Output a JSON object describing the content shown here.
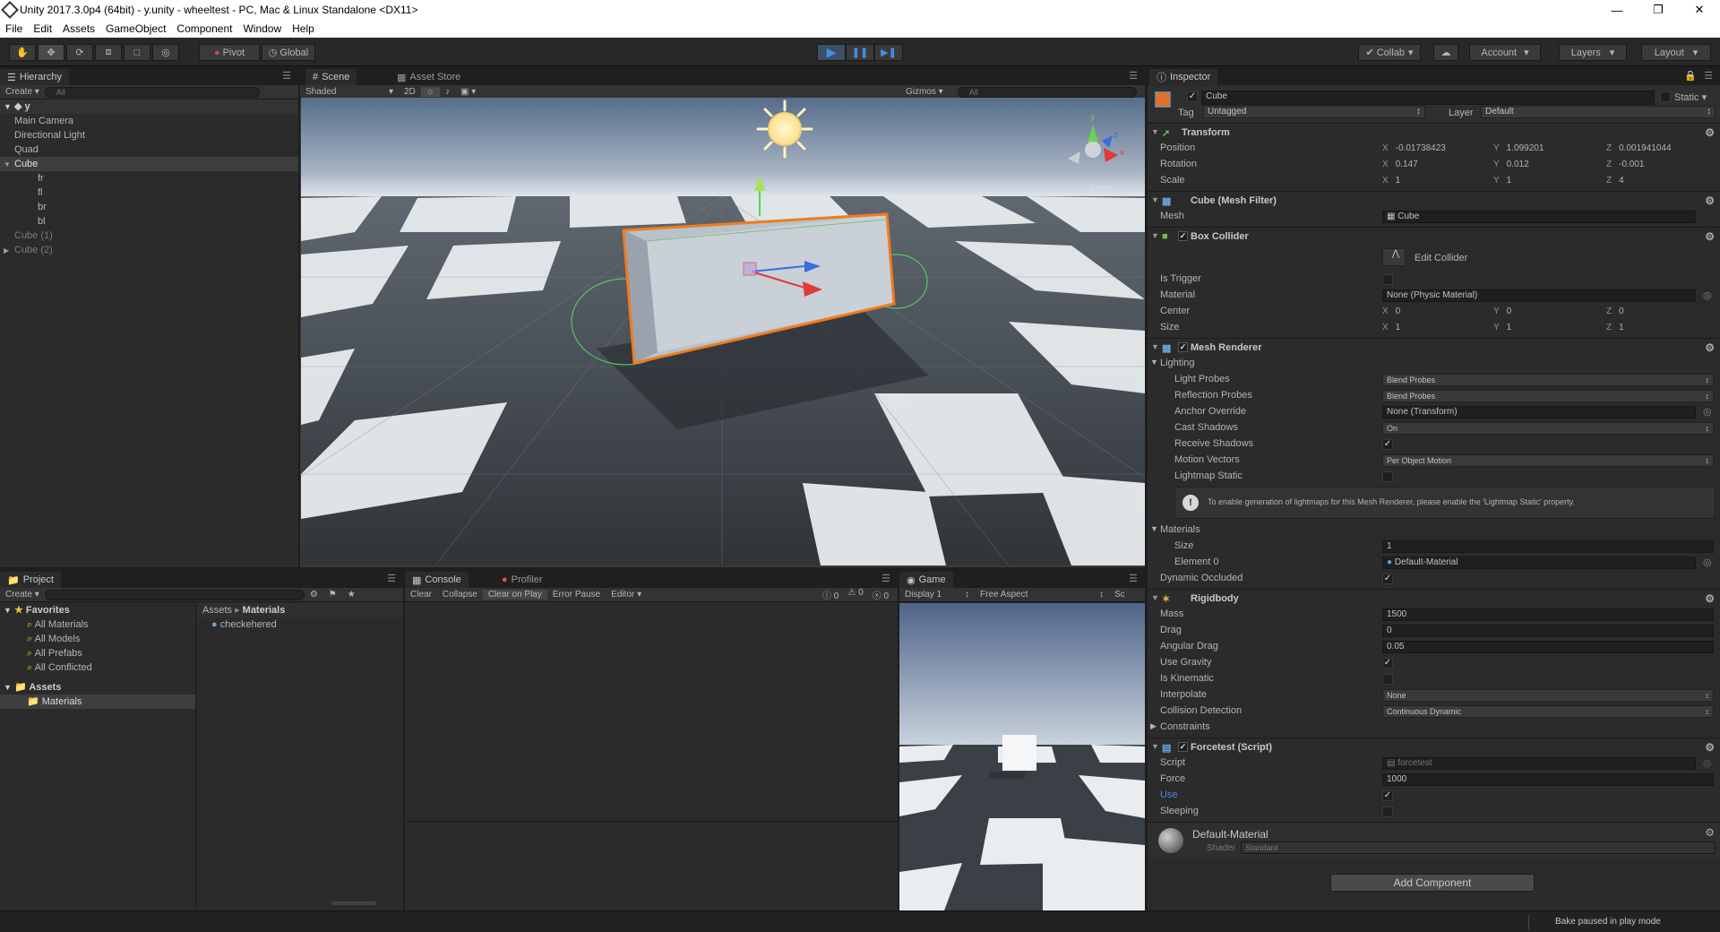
{
  "window": {
    "title": "Unity 2017.3.0p4 (64bit) - y.unity - wheeltest - PC, Mac & Linux Standalone <DX11>"
  },
  "menu": [
    "File",
    "Edit",
    "Assets",
    "GameObject",
    "Component",
    "Window",
    "Help"
  ],
  "toolbar": {
    "pivot": "Pivot",
    "global": "Global",
    "collab": "Collab",
    "account": "Account",
    "layers": "Layers",
    "layout": "Layout"
  },
  "hierarchy": {
    "tab": "Hierarchy",
    "create": "Create",
    "search_placeholder": "All",
    "scene_name": "y",
    "items": [
      {
        "label": "Main Camera",
        "depth": 1
      },
      {
        "label": "Directional Light",
        "depth": 1
      },
      {
        "label": "Quad",
        "depth": 1
      },
      {
        "label": "Cube",
        "depth": 1,
        "selected": true,
        "expanded": true
      },
      {
        "label": "fr",
        "depth": 2
      },
      {
        "label": "fl",
        "depth": 2
      },
      {
        "label": "br",
        "depth": 2
      },
      {
        "label": "bl",
        "depth": 2
      },
      {
        "label": "Cube (1)",
        "depth": 1,
        "muted": true
      },
      {
        "label": "Cube (2)",
        "depth": 1,
        "muted": true,
        "collapsed": true
      }
    ]
  },
  "scene": {
    "tabs": [
      "Scene",
      "Asset Store"
    ],
    "shading": "Shaded",
    "mode2d": "2D",
    "gizmos": "Gizmos",
    "search_placeholder": "All",
    "persp": "Persp"
  },
  "project": {
    "tab": "Project",
    "create": "Create",
    "favorites": {
      "label": "Favorites",
      "items": [
        "All Materials",
        "All Models",
        "All Prefabs",
        "All Conflicted"
      ]
    },
    "assets": {
      "label": "Assets",
      "items": [
        "Materials"
      ]
    },
    "breadcrumb": [
      "Assets",
      "Materials"
    ],
    "files": [
      "checkehered"
    ]
  },
  "console": {
    "tabs": [
      "Console",
      "Profiler"
    ],
    "buttons": [
      "Clear",
      "Collapse",
      "Clear on Play",
      "Error Pause",
      "Editor"
    ],
    "counts": [
      "0",
      "0",
      "0"
    ]
  },
  "game": {
    "tab": "Game",
    "display": "Display 1",
    "aspect": "Free Aspect",
    "scale": "Sc"
  },
  "inspector": {
    "tab": "Inspector",
    "object_name": "Cube",
    "static": "Static",
    "tag_label": "Tag",
    "tag": "Untagged",
    "layer_label": "Layer",
    "layer": "Default",
    "transform": {
      "title": "Transform",
      "rows": [
        {
          "label": "Position",
          "x": "-0.01738423",
          "y": "1.099201",
          "z": "0.001941044"
        },
        {
          "label": "Rotation",
          "x": "0.147",
          "y": "0.012",
          "z": "-0.001"
        },
        {
          "label": "Scale",
          "x": "1",
          "y": "1",
          "z": "4"
        }
      ]
    },
    "mesh_filter": {
      "title": "Cube (Mesh Filter)",
      "mesh_label": "Mesh",
      "mesh": "Cube"
    },
    "box_collider": {
      "title": "Box Collider",
      "edit": "Edit Collider",
      "is_trigger": "Is Trigger",
      "material_label": "Material",
      "material": "None (Physic Material)",
      "center": {
        "label": "Center",
        "x": "0",
        "y": "0",
        "z": "0"
      },
      "size": {
        "label": "Size",
        "x": "1",
        "y": "1",
        "z": "1"
      }
    },
    "mesh_renderer": {
      "title": "Mesh Renderer",
      "lighting": "Lighting",
      "light_probes": {
        "label": "Light Probes",
        "value": "Blend Probes"
      },
      "reflection_probes": {
        "label": "Reflection Probes",
        "value": "Blend Probes"
      },
      "anchor_override": {
        "label": "Anchor Override",
        "value": "None (Transform)"
      },
      "cast_shadows": {
        "label": "Cast Shadows",
        "value": "On"
      },
      "receive_shadows": "Receive Shadows",
      "motion_vectors": {
        "label": "Motion Vectors",
        "value": "Per Object Motion"
      },
      "lightmap_static": "Lightmap Static",
      "info": "To enable generation of lightmaps for this Mesh Renderer, please enable the 'Lightmap Static' property.",
      "materials": "Materials",
      "size_label": "Size",
      "size": "1",
      "element_label": "Element 0",
      "element": "Default-Material",
      "dynamic_occluded": "Dynamic Occluded"
    },
    "rigidbody": {
      "title": "Rigidbody",
      "mass_label": "Mass",
      "mass": "1500",
      "drag_label": "Drag",
      "drag": "0",
      "angular_drag_label": "Angular Drag",
      "angular_drag": "0.05",
      "use_gravity": "Use Gravity",
      "is_kinematic": "Is Kinematic",
      "interpolate_label": "Interpolate",
      "interpolate": "None",
      "collision_label": "Collision Detection",
      "collision": "Continuous Dynamic",
      "constraints": "Constraints"
    },
    "script": {
      "title": "Forcetest (Script)",
      "script_label": "Script",
      "script": "forcetest",
      "force_label": "Force",
      "force": "1000",
      "use_label": "Use",
      "sleeping_label": "Sleeping"
    },
    "material": {
      "name": "Default-Material",
      "shader_label": "Shader",
      "shader": "Standard"
    },
    "add_component": "Add Component"
  },
  "status": {
    "text": "Bake paused in play mode"
  }
}
